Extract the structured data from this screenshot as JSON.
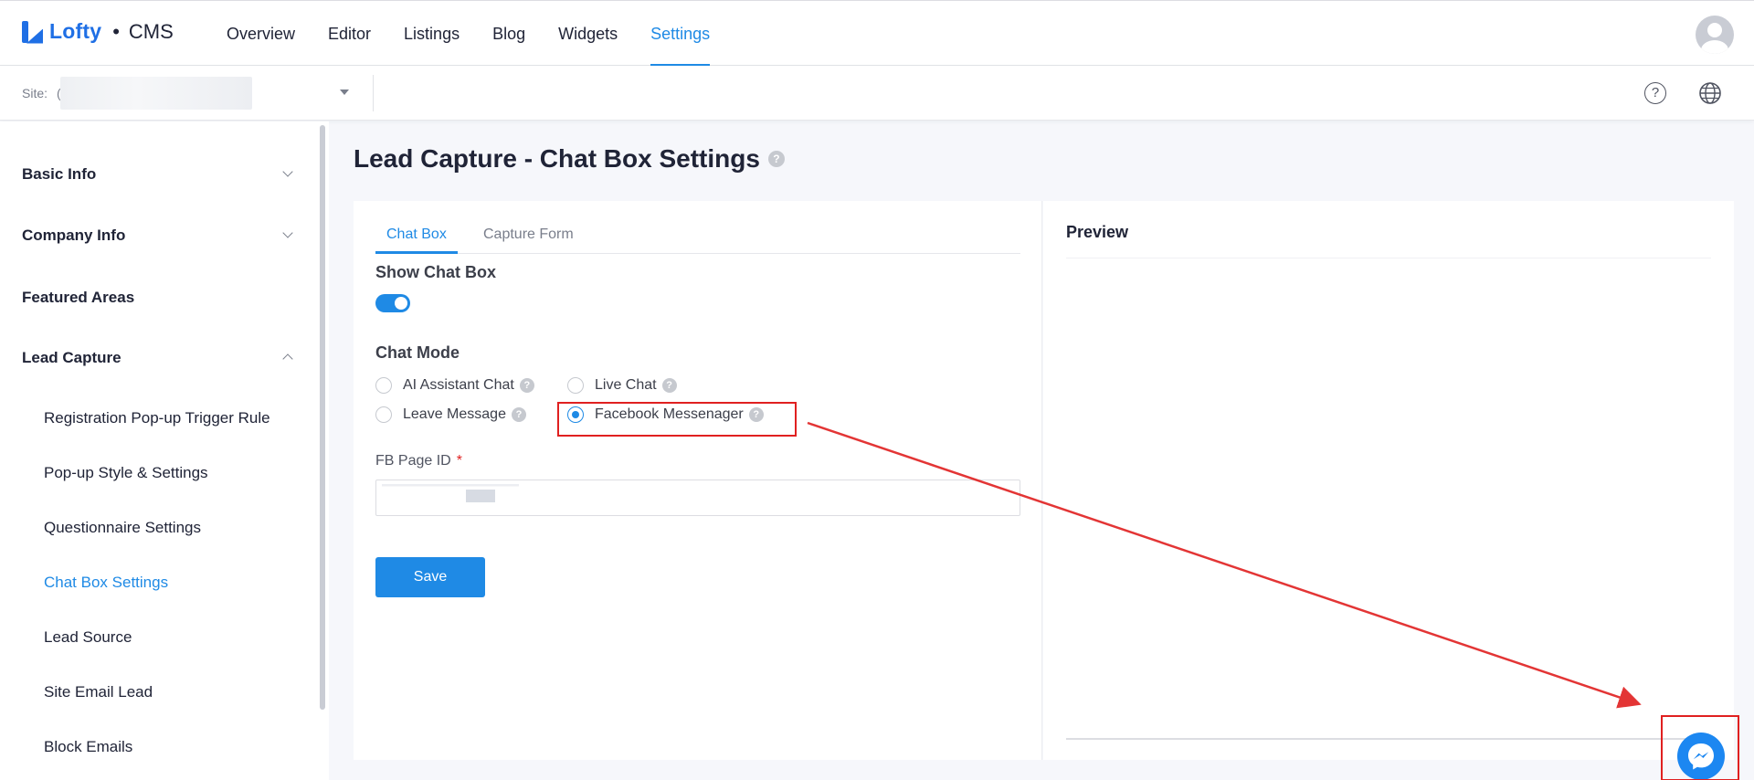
{
  "brand": {
    "logo_text": "Lofty",
    "separator": "•",
    "product": "CMS"
  },
  "nav": {
    "items": [
      {
        "label": "Overview",
        "active": false
      },
      {
        "label": "Editor",
        "active": false
      },
      {
        "label": "Listings",
        "active": false
      },
      {
        "label": "Blog",
        "active": false
      },
      {
        "label": "Widgets",
        "active": false
      },
      {
        "label": "Settings",
        "active": true
      }
    ]
  },
  "site_bar": {
    "label": "Site:",
    "value": "("
  },
  "sidebar": {
    "sections": [
      {
        "label": "Basic Info",
        "chevron": "chevron-down-icon"
      },
      {
        "label": "Company Info",
        "chevron": "chevron-down-icon"
      },
      {
        "label": "Featured Areas"
      },
      {
        "label": "Lead Capture",
        "chevron": "chevron-up-icon"
      }
    ],
    "sub_items": [
      "Registration Pop-up Trigger Rule",
      "Pop-up Style & Settings",
      "Questionnaire Settings",
      "Chat Box Settings",
      "Lead Source",
      "Site Email Lead",
      "Block Emails"
    ],
    "active_sub": "Chat Box Settings"
  },
  "page": {
    "title": "Lead Capture - Chat Box Settings",
    "help_glyph": "?"
  },
  "tabs": [
    {
      "label": "Chat Box",
      "active": true
    },
    {
      "label": "Capture Form",
      "active": false
    }
  ],
  "form": {
    "show_chat_box": {
      "label": "Show Chat Box",
      "enabled": true
    },
    "chat_mode": {
      "label": "Chat Mode",
      "options": [
        {
          "label": "AI Assistant Chat",
          "selected": false
        },
        {
          "label": "Live Chat",
          "selected": false
        },
        {
          "label": "Leave Message",
          "selected": false
        },
        {
          "label": "Facebook Messenager",
          "selected": true
        }
      ]
    },
    "fb_page_id": {
      "label": "FB Page ID",
      "required_mark": "*",
      "value": ""
    },
    "save_label": "Save"
  },
  "preview": {
    "title": "Preview",
    "widget_icon": "messenger-icon"
  },
  "colors": {
    "accent": "#1f8ae5",
    "brand": "#1f6fe5",
    "annotation": "#e02020",
    "messenger": "#1c87f1"
  }
}
